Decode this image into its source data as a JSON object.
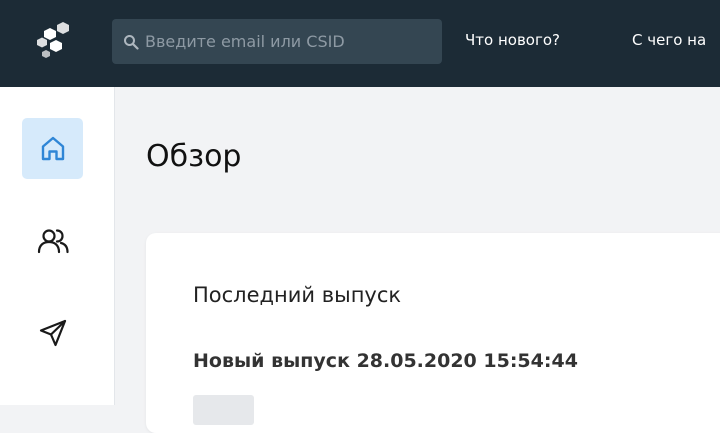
{
  "header": {
    "search_placeholder": "Введите email или CSID",
    "nav": [
      "Что нового?",
      "С чего на"
    ]
  },
  "sidebar": {
    "items": [
      {
        "icon": "home-icon",
        "active": true
      },
      {
        "icon": "users-icon",
        "active": false
      },
      {
        "icon": "send-icon",
        "active": false
      }
    ]
  },
  "main": {
    "title": "Обзор",
    "card": {
      "title": "Последний выпуск",
      "release_text": "Новый выпуск 28.05.2020 15:54:44"
    }
  },
  "colors": {
    "header_bg": "#1c2b36",
    "search_bg": "#344652",
    "active_bg": "#d6eafb",
    "accent": "#2f86d6"
  }
}
